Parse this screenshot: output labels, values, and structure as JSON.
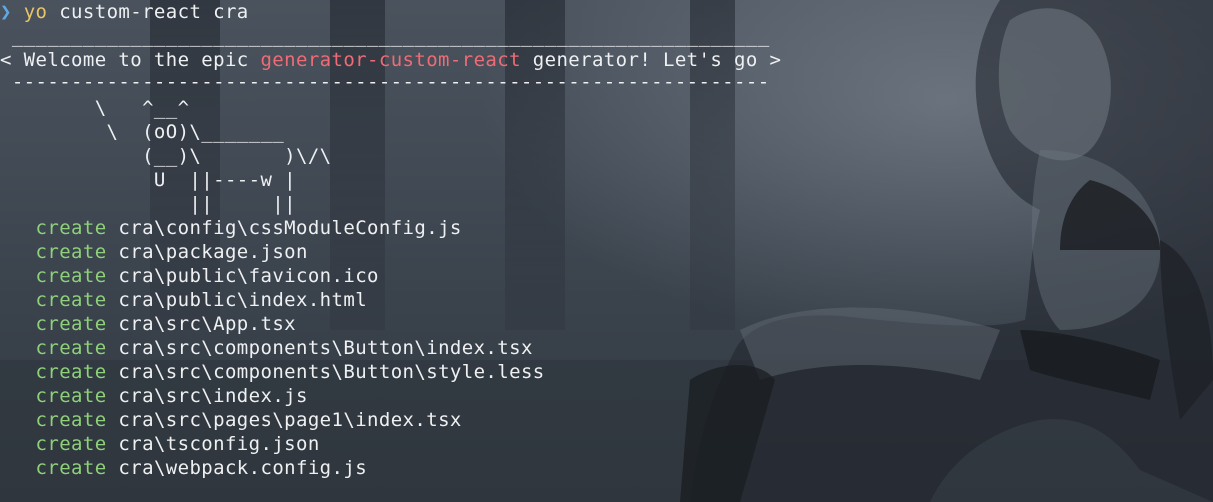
{
  "prompt": {
    "symbol": "❯",
    "command": "yo",
    "args": " custom-react cra"
  },
  "banner": {
    "rule_top": " ________________________________________________________________",
    "pre": "< Welcome to the epic ",
    "highlight": "generator-custom-react",
    "post": " generator! Let's go >",
    "rule_bottom": " ----------------------------------------------------------------"
  },
  "cow": [
    "        \\   ^__^",
    "         \\  (oO)\\_______",
    "            (__)\\       )\\/\\",
    "             U  ||----w |",
    "                ||     ||"
  ],
  "create_verb": "create",
  "files": [
    "cra\\config\\cssModuleConfig.js",
    "cra\\package.json",
    "cra\\public\\favicon.ico",
    "cra\\public\\index.html",
    "cra\\src\\App.tsx",
    "cra\\src\\components\\Button\\index.tsx",
    "cra\\src\\components\\Button\\style.less",
    "cra\\src\\index.js",
    "cra\\src\\pages\\page1\\index.tsx",
    "cra\\tsconfig.json",
    "cra\\webpack.config.js"
  ],
  "colors": {
    "background": "#323a44",
    "prompt": "#5fa8e6",
    "command": "#e8c46a",
    "highlight": "#f06b75",
    "create": "#8fd07a",
    "text": "#eef0f2"
  }
}
